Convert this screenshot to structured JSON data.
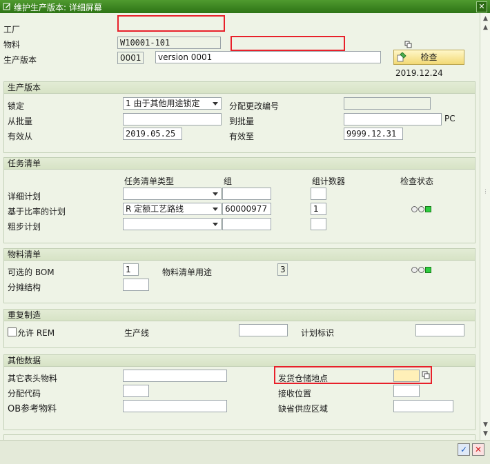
{
  "window": {
    "title": "维护生产版本: 详细屏幕",
    "close_symbol": "✕"
  },
  "header": {
    "plant_label": "工厂",
    "material_label": "物料",
    "material_value": "W10001-101",
    "version_label": "生产版本",
    "version_value": "0001",
    "version_text": "version 0001",
    "check_button": "检查",
    "check_date": "2019.12.24"
  },
  "sections": {
    "production_version": {
      "title": "生产版本",
      "lock_label": "锁定",
      "lock_value": "1 由于其他用途锁定",
      "alloc_change_label": "分配更改编号",
      "from_lot_label": "从批量",
      "to_lot_label": "到批量",
      "unit": "PC",
      "valid_from_label": "有效从",
      "valid_from_value": "2019.05.25",
      "valid_to_label": "有效至",
      "valid_to_value": "9999.12.31"
    },
    "task_list": {
      "title": "任务清单",
      "col_type": "任务清单类型",
      "col_group": "组",
      "col_counter": "组计数器",
      "col_status": "检查状态",
      "rows": [
        {
          "label": "详细计划",
          "type": "",
          "group": "",
          "counter": ""
        },
        {
          "label": "基于比率的计划",
          "type": "R 定额工艺路线",
          "group": "60000977",
          "counter": "1"
        },
        {
          "label": "粗步计划",
          "type": "",
          "group": "",
          "counter": ""
        }
      ]
    },
    "bom": {
      "title": "物料清单",
      "alt_bom_label": "可选的 BOM",
      "alt_bom_value": "1",
      "bom_usage_label": "物料清单用途",
      "bom_usage_value": "3",
      "apportion_label": "分摊结构"
    },
    "repetitive": {
      "title": "重复制造",
      "allow_rem_label": "允许 REM",
      "prod_line_label": "生产线",
      "planning_id_label": "计划标识"
    },
    "other": {
      "title": "其他数据",
      "other_header_material_label": "其它表头物料",
      "issue_sloc_label": "发货仓储地点",
      "alloc_code_label": "分配代码",
      "receiving_loc_label": "接收位置",
      "ob_ref_material_label": "OB参考物料",
      "default_supply_area_label": "缺省供应区域"
    }
  },
  "footer": {
    "confirm_symbol": "✓",
    "cancel_symbol": "✕"
  },
  "colors": {
    "accent_green": "#3a8a1f",
    "highlight_red": "#e8202a",
    "button_yellow": "#f2d975"
  }
}
